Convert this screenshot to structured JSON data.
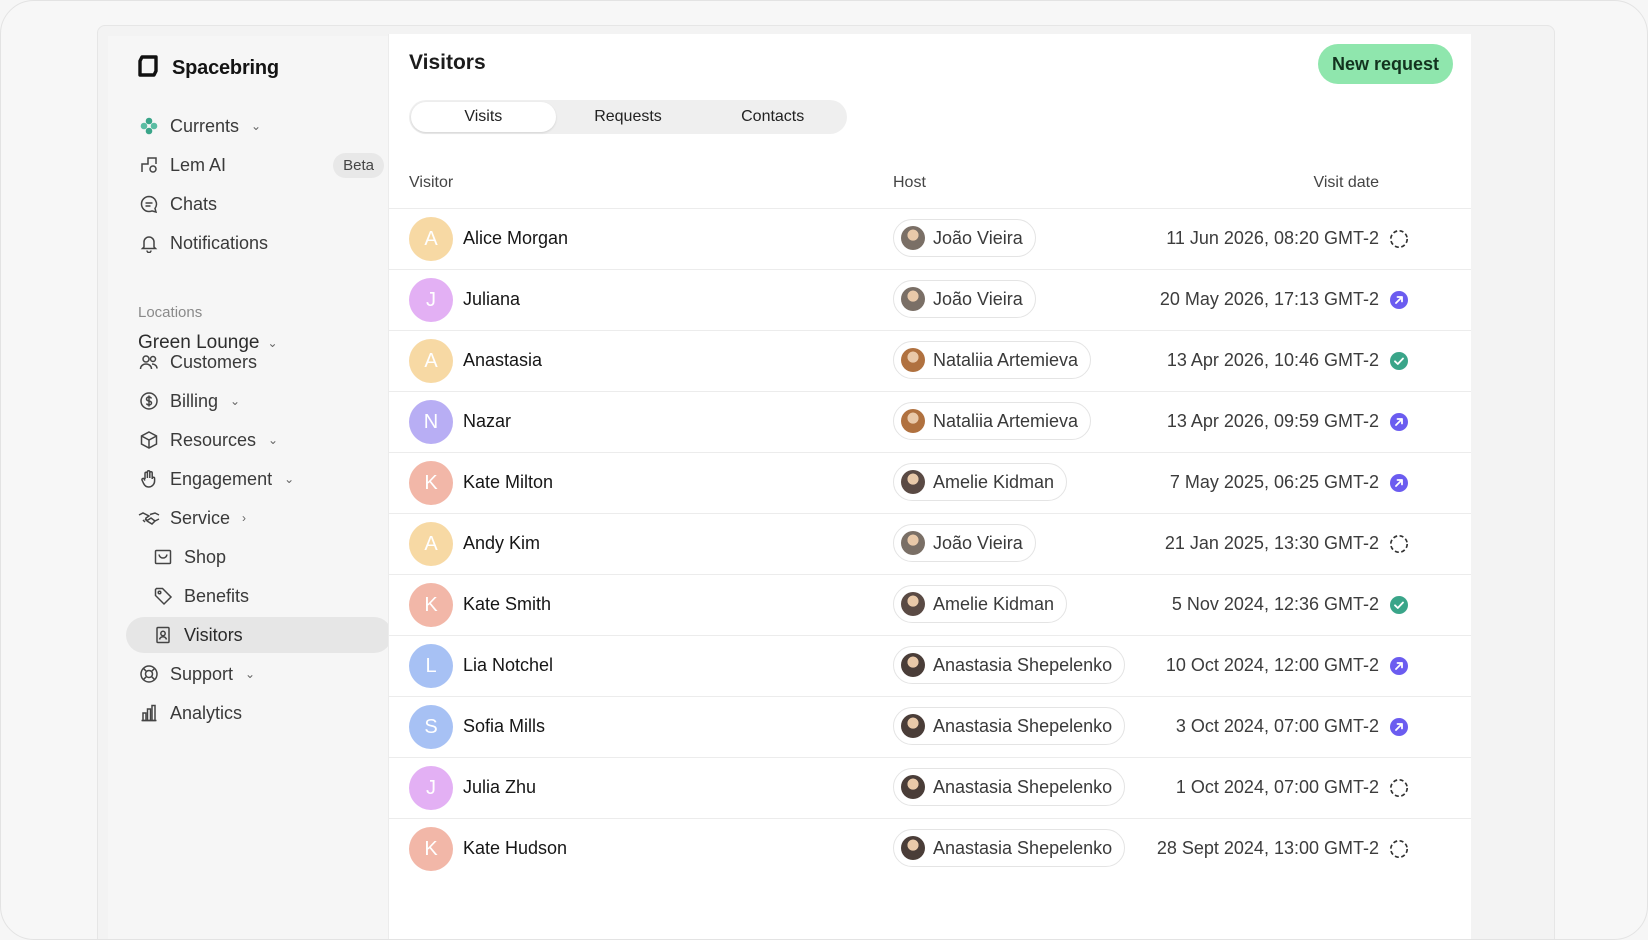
{
  "brand": {
    "name": "Spacebring"
  },
  "nav": {
    "currents": "Currents",
    "lem_ai": "Lem AI",
    "beta_badge": "Beta",
    "chats": "Chats",
    "notifications": "Notifications",
    "locations_label": "Locations",
    "location": "Green Lounge",
    "customers": "Customers",
    "billing": "Billing",
    "resources": "Resources",
    "engagement": "Engagement",
    "service": "Service",
    "shop": "Shop",
    "benefits": "Benefits",
    "visitors": "Visitors",
    "support": "Support",
    "analytics": "Analytics"
  },
  "main": {
    "title": "Visitors",
    "new_request": "New request",
    "tabs": [
      "Visits",
      "Requests",
      "Contacts"
    ],
    "columns": {
      "visitor": "Visitor",
      "host": "Host",
      "date": "Visit date"
    }
  },
  "colors": {
    "accent_button": "#8fe6ad",
    "status_arrow": "#6b5cf0",
    "status_done": "#3aa589",
    "status_pending": "#333333"
  },
  "visits": [
    {
      "initial": "A",
      "name": "Alice Morgan",
      "avatar_color": "#f7d9a4",
      "host": "João Vieira",
      "date": "11 Jun 2026, 08:20 GMT-2",
      "status": "pending"
    },
    {
      "initial": "J",
      "name": "Juliana",
      "avatar_color": "#e3b0f4",
      "host": "João Vieira",
      "date": "20 May 2026, 17:13 GMT-2",
      "status": "arrow"
    },
    {
      "initial": "A",
      "name": "Anastasia",
      "avatar_color": "#f7d9a4",
      "host": "Nataliia Artemieva",
      "date": "13 Apr 2026, 10:46 GMT-2",
      "status": "done"
    },
    {
      "initial": "N",
      "name": "Nazar",
      "avatar_color": "#b8aef4",
      "host": "Nataliia Artemieva",
      "date": "13 Apr 2026, 09:59 GMT-2",
      "status": "arrow"
    },
    {
      "initial": "K",
      "name": "Kate Milton",
      "avatar_color": "#f2b7a8",
      "host": "Amelie Kidman",
      "date": "7 May 2025, 06:25 GMT-2",
      "status": "arrow"
    },
    {
      "initial": "A",
      "name": "Andy Kim",
      "avatar_color": "#f7d9a4",
      "host": "João Vieira",
      "date": "21 Jan 2025, 13:30 GMT-2",
      "status": "pending"
    },
    {
      "initial": "K",
      "name": "Kate Smith",
      "avatar_color": "#f2b7a8",
      "host": "Amelie Kidman",
      "date": "5 Nov 2024, 12:36 GMT-2",
      "status": "done"
    },
    {
      "initial": "L",
      "name": "Lia Notchel",
      "avatar_color": "#a7c1f4",
      "host": "Anastasia Shepelenko",
      "date": "10 Oct 2024, 12:00 GMT-2",
      "status": "arrow"
    },
    {
      "initial": "S",
      "name": "Sofia Mills",
      "avatar_color": "#a7c1f4",
      "host": "Anastasia Shepelenko",
      "date": "3 Oct 2024, 07:00 GMT-2",
      "status": "arrow"
    },
    {
      "initial": "J",
      "name": "Julia Zhu",
      "avatar_color": "#e3b0f4",
      "host": "Anastasia Shepelenko",
      "date": "1 Oct 2024, 07:00 GMT-2",
      "status": "pending"
    },
    {
      "initial": "K",
      "name": "Kate Hudson",
      "avatar_color": "#f2b7a8",
      "host": "Anastasia Shepelenko",
      "date": "28 Sept 2024, 13:00 GMT-2",
      "status": "pending"
    }
  ]
}
